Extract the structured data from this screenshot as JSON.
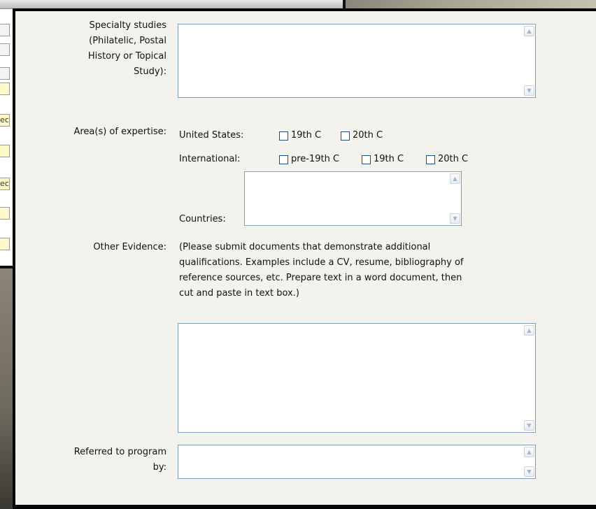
{
  "background_window": {
    "row_fragments": [
      "",
      "",
      "",
      "",
      "ec",
      "",
      "ec",
      "",
      ""
    ]
  },
  "form": {
    "specialty": {
      "label": "Specialty studies\n(Philatelic, Postal\nHistory or Topical\nStudy):",
      "value": ""
    },
    "expertise": {
      "label": "Area(s) of expertise:",
      "us_label": "United States:",
      "us_options": [
        "19th C",
        "20th C"
      ],
      "intl_label": "International:",
      "intl_options": [
        "pre-19th C",
        "19th C",
        "20th C"
      ],
      "countries_label": "Countries:",
      "countries_value": ""
    },
    "other_evidence": {
      "label": "Other Evidence:",
      "instructions": "(Please submit documents that demonstrate additional\nqualifications. Examples include a CV, resume, bibliography of\nreference sources, etc. Prepare text in a word document, then\ncut and paste in text box.)",
      "value": ""
    },
    "referred": {
      "label": "Referred to program\nby:",
      "value": ""
    }
  },
  "icons": {
    "scroll_up": "▲",
    "scroll_down": "▼"
  },
  "colors": {
    "dialog_bg": "#f3f2ec",
    "textarea_border": "#7f9db9",
    "checkbox_border": "#1c5180"
  }
}
